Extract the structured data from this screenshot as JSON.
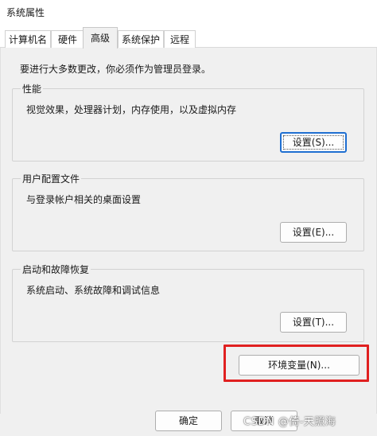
{
  "window": {
    "title": "系统属性"
  },
  "tabs": [
    {
      "label": "计算机名",
      "active": false
    },
    {
      "label": "硬件",
      "active": false
    },
    {
      "label": "高级",
      "active": true
    },
    {
      "label": "系统保护",
      "active": false
    },
    {
      "label": "远程",
      "active": false
    }
  ],
  "notice": "要进行大多数更改，你必须作为管理员登录。",
  "groups": {
    "performance": {
      "title": "性能",
      "description": "视觉效果，处理器计划，内存使用，以及虚拟内存",
      "button": "设置(S)..."
    },
    "user_profiles": {
      "title": "用户配置文件",
      "description": "与登录帐户相关的桌面设置",
      "button": "设置(E)..."
    },
    "startup_recovery": {
      "title": "启动和故障恢复",
      "description": "系统启动、系统故障和调试信息",
      "button": "设置(T)..."
    }
  },
  "env_button": "环境变量(N)...",
  "footer": {
    "ok": "确定",
    "cancel": "取消"
  },
  "watermark": "CSDN @倚-天照海",
  "colors": {
    "highlight": "#e02020",
    "focus": "#1f6fd1"
  }
}
